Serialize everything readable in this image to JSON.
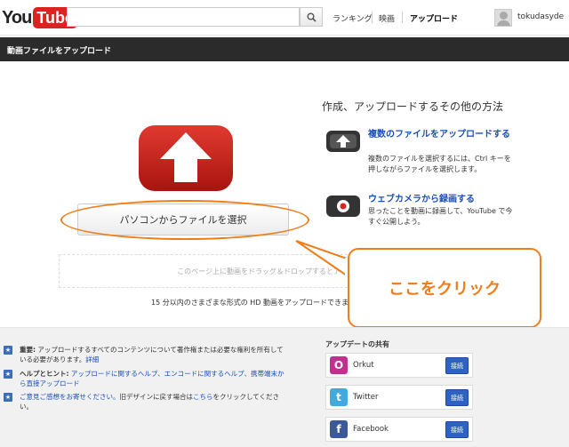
{
  "header": {
    "logo_you": "You",
    "logo_tube": "Tube",
    "search_placeholder": "",
    "nav": [
      "ランキング",
      "映画",
      "アップロード"
    ],
    "username": "tokudasyde"
  },
  "titlebar": {
    "title": "動画ファイルをアップロード"
  },
  "upload": {
    "select_button": "パソコンからファイルを選択",
    "drop_hint": "このページ上に動画をドラッグ＆ドロップするとアップ",
    "hd_note": "15 分以内のさまざまな形式の HD 動画をアップロードできま"
  },
  "other_methods": {
    "heading": "作成、アップロードするその他の方法",
    "items": [
      {
        "icon": "multi-upload-icon",
        "title": "複数のファイルをアップロードする",
        "desc": "複数のファイルを選択するには、Ctrl キーを押しながらファイルを選択します。"
      },
      {
        "icon": "webcam-record-icon",
        "title": "ウェブカメラから録画する",
        "desc": "思ったことを動画に録画して、YouTube で今すぐ公開しよう。"
      }
    ]
  },
  "callout": {
    "text": "ここをクリック"
  },
  "notices": [
    {
      "bold": "重要:",
      "text": " アップロードするすべてのコンテンツについて著作権または必要な権利を所有している必要があります。",
      "link": "詳細"
    },
    {
      "bold": "ヘルプとヒント:",
      "text": " ",
      "link": "アップロードに関するヘルプ、エンコードに関するヘルプ、携帯端末から直接アップロード"
    },
    {
      "bold": "",
      "text": "",
      "link": "ご意見ご感想をお寄せください。",
      "tail": "旧デザインに戻す場合は",
      "link2": "こちら",
      "tail2": "をクリックしてください。"
    }
  ],
  "share": {
    "title": "アップデートの共有",
    "items": [
      {
        "name": "Orkut",
        "button": "接続",
        "color": "#c22f8f",
        "glyph": "O"
      },
      {
        "name": "Twitter",
        "button": "接続",
        "color": "#3fa9e0",
        "glyph": "t"
      },
      {
        "name": "Facebook",
        "button": "接続",
        "color": "#3b5998",
        "glyph": "f"
      }
    ]
  },
  "colors": {
    "accent_orange": "#f07d1a",
    "youtube_red": "#d22",
    "link_blue": "#1a4fb8"
  }
}
